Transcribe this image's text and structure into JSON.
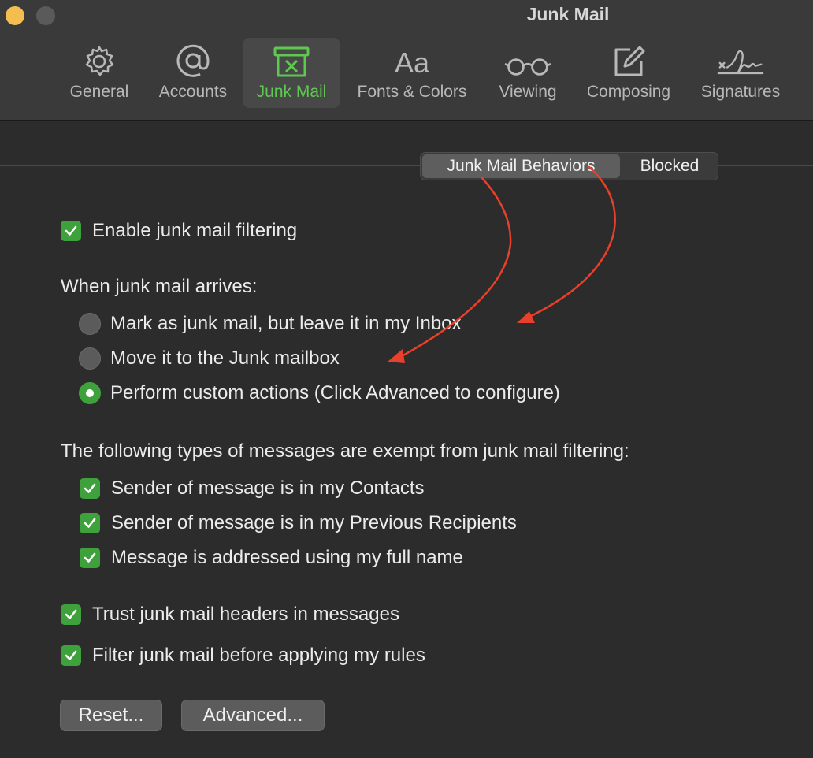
{
  "window": {
    "title": "Junk Mail"
  },
  "toolbar": {
    "items": [
      {
        "label": "General",
        "icon": "gear-icon"
      },
      {
        "label": "Accounts",
        "icon": "at-icon"
      },
      {
        "label": "Junk Mail",
        "icon": "junk-bin-icon",
        "active": true
      },
      {
        "label": "Fonts & Colors",
        "icon": "fonts-icon",
        "glyph": "Aa"
      },
      {
        "label": "Viewing",
        "icon": "glasses-icon"
      },
      {
        "label": "Composing",
        "icon": "compose-icon"
      },
      {
        "label": "Signatures",
        "icon": "signature-icon"
      }
    ]
  },
  "tabs": {
    "selected": "Junk Mail Behaviors",
    "other": "Blocked"
  },
  "enable_filtering": {
    "label": "Enable junk mail filtering",
    "checked": true
  },
  "arrival": {
    "heading": "When junk mail arrives:",
    "options": [
      {
        "label": "Mark as junk mail, but leave it in my Inbox",
        "selected": false
      },
      {
        "label": "Move it to the Junk mailbox",
        "selected": false
      },
      {
        "label": "Perform custom actions (Click Advanced to configure)",
        "selected": true
      }
    ]
  },
  "exempt": {
    "heading": "The following types of messages are exempt from junk mail filtering:",
    "items": [
      {
        "label": "Sender of message is in my Contacts",
        "checked": true
      },
      {
        "label": "Sender of message is in my Previous Recipients",
        "checked": true
      },
      {
        "label": "Message is addressed using my full name",
        "checked": true
      }
    ]
  },
  "trust_headers": {
    "label": "Trust junk mail headers in messages",
    "checked": true
  },
  "filter_before_rules": {
    "label": "Filter junk mail before applying my rules",
    "checked": true
  },
  "buttons": {
    "reset": "Reset...",
    "advanced": "Advanced..."
  },
  "colors": {
    "accent": "#3fa13b",
    "active_tab_text": "#5ec94f",
    "annotation": "#e8402a"
  }
}
